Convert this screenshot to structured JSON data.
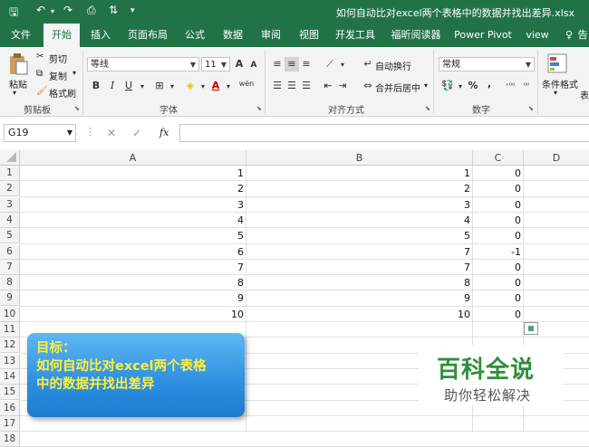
{
  "title": "如何自动比对excel两个表格中的数据并找出差异.xlsx",
  "tabs": [
    {
      "label": "文件"
    },
    {
      "label": "开始"
    },
    {
      "label": "插入"
    },
    {
      "label": "页面布局"
    },
    {
      "label": "公式"
    },
    {
      "label": "数据"
    },
    {
      "label": "审阅"
    },
    {
      "label": "视图"
    },
    {
      "label": "开发工具"
    },
    {
      "label": "福昕阅读器"
    },
    {
      "label": "Power Pivot"
    },
    {
      "label": "view"
    },
    {
      "label": "告"
    }
  ],
  "ribbon": {
    "clipboard": {
      "label": "剪贴板",
      "paste": "粘贴",
      "cut": "剪切",
      "copy": "复制",
      "format_painter": "格式刷"
    },
    "font": {
      "label": "字体",
      "name": "等线",
      "size": "11",
      "bold": "B",
      "italic": "I",
      "underline": "U",
      "grow": "A",
      "shrink": "A",
      "wen": "wén"
    },
    "alignment": {
      "label": "对齐方式",
      "wrap": "自动换行",
      "merge": "合并后居中"
    },
    "number": {
      "label": "数字",
      "format": "常规",
      "percent": "%",
      "comma": ","
    },
    "styles": {
      "cond_format": "条件格式",
      "table": "表"
    }
  },
  "formula_bar": {
    "name_box": "G19",
    "cancel": "✕",
    "enter": "✓",
    "fx": "fx"
  },
  "columns": [
    "A",
    "B",
    "C",
    "D"
  ],
  "rows": [
    "1",
    "2",
    "3",
    "4",
    "5",
    "6",
    "7",
    "8",
    "9",
    "10",
    "11",
    "12",
    "13",
    "14",
    "15",
    "16",
    "17",
    "18"
  ],
  "table_data": {
    "A": [
      "1",
      "2",
      "3",
      "4",
      "5",
      "6",
      "7",
      "8",
      "9",
      "10"
    ],
    "B": [
      "1",
      "2",
      "3",
      "4",
      "5",
      "7",
      "7",
      "8",
      "9",
      "10"
    ],
    "C": [
      "0",
      "0",
      "0",
      "0",
      "0",
      "-1",
      "0",
      "0",
      "0",
      "0"
    ]
  },
  "goal_box": {
    "line1": "目标：",
    "line2": "如何自动比对excel两个表格",
    "line3": "中的数据并找出差异"
  },
  "watermark": {
    "line1": "百科全说",
    "line2": "助你轻松解决"
  },
  "colors": {
    "brand": "#217346",
    "goal_text": "#ffef3c",
    "goal_bg": "#2b8fe0",
    "watermark": "#2f8f3b"
  }
}
